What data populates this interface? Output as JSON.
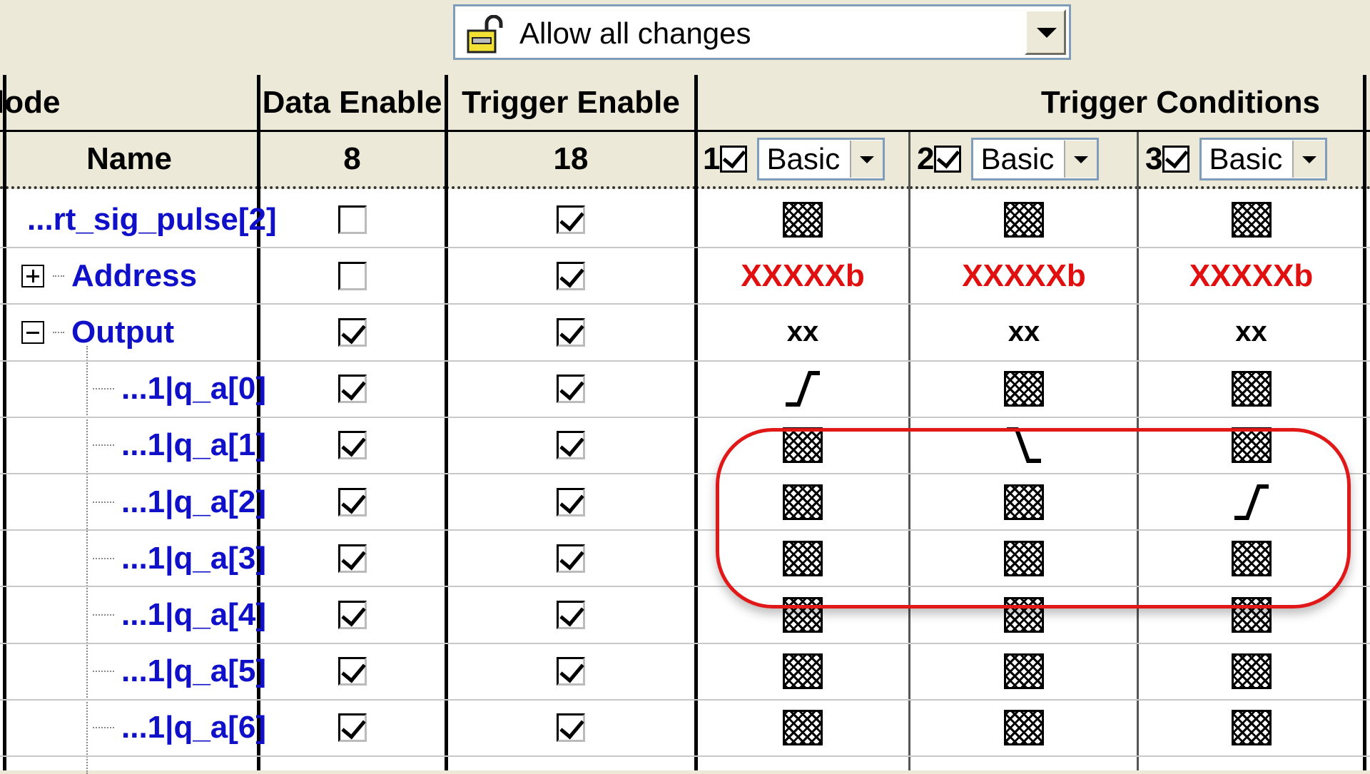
{
  "mode_selector": {
    "label": "Allow all changes",
    "icon": "unlock-icon"
  },
  "columns": {
    "node": {
      "group_label": "lode",
      "name_label": "Name"
    },
    "data_enable": {
      "label": "Data Enable",
      "count": "8"
    },
    "trigger_enable": {
      "label": "Trigger Enable",
      "count": "18"
    },
    "trigger_conditions": {
      "label": "Trigger Conditions",
      "conditions": [
        {
          "index": "1",
          "enabled": true,
          "type": "Basic"
        },
        {
          "index": "2",
          "enabled": true,
          "type": "Basic"
        },
        {
          "index": "3",
          "enabled": true,
          "type": "Basic"
        }
      ]
    }
  },
  "rows": [
    {
      "name": "...rt_sig_pulse[2]",
      "data": false,
      "trigger": true,
      "conditions": [
        "dc",
        "dc",
        "dc"
      ]
    },
    {
      "name": "Address",
      "expander": "plus",
      "data": false,
      "trigger": true,
      "conditions": [
        "XXXXXb",
        "XXXXXb",
        "XXXXXb"
      ]
    },
    {
      "name": "Output",
      "expander": "minus",
      "data": true,
      "trigger": true,
      "conditions": [
        "xx",
        "xx",
        "xx"
      ]
    },
    {
      "name": "...1|q_a[0]",
      "child": true,
      "data": true,
      "trigger": true,
      "conditions": [
        "rising",
        "dc",
        "dc"
      ]
    },
    {
      "name": "...1|q_a[1]",
      "child": true,
      "data": true,
      "trigger": true,
      "conditions": [
        "dc",
        "falling",
        "dc"
      ]
    },
    {
      "name": "...1|q_a[2]",
      "child": true,
      "data": true,
      "trigger": true,
      "conditions": [
        "dc",
        "dc",
        "rising"
      ]
    },
    {
      "name": "...1|q_a[3]",
      "child": true,
      "data": true,
      "trigger": true,
      "conditions": [
        "dc",
        "dc",
        "dc"
      ]
    },
    {
      "name": "...1|q_a[4]",
      "child": true,
      "data": true,
      "trigger": true,
      "conditions": [
        "dc",
        "dc",
        "dc"
      ]
    },
    {
      "name": "...1|q_a[5]",
      "child": true,
      "data": true,
      "trigger": true,
      "conditions": [
        "dc",
        "dc",
        "dc"
      ]
    },
    {
      "name": "...1|q_a[6]",
      "child": true,
      "data": true,
      "trigger": true,
      "conditions": [
        "dc",
        "dc",
        "dc"
      ]
    }
  ],
  "colors": {
    "node_text": "#1010c8",
    "value_red": "#e01010",
    "highlight": "#e01818"
  }
}
